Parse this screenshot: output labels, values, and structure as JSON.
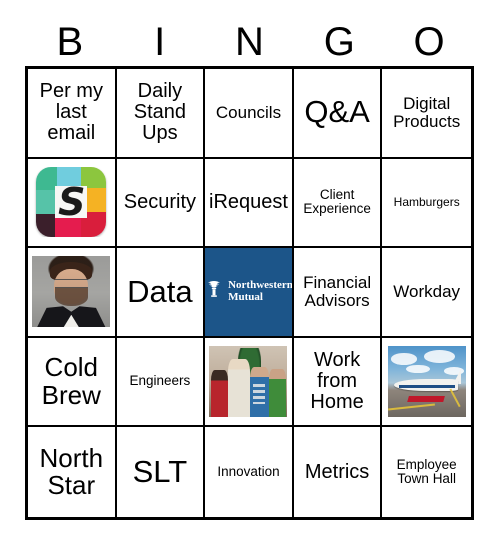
{
  "header": {
    "letters": [
      "B",
      "I",
      "N",
      "G",
      "O"
    ]
  },
  "colors": {
    "grid_line": "#000000",
    "cell_background": "#ffffff",
    "northwestern_mutual_blue": "#1c5589",
    "page_background": "#ffffff"
  },
  "grid": {
    "rows": 5,
    "columns": 5,
    "cells": [
      {
        "id": "b1",
        "column": "B",
        "row": 1,
        "type": "text",
        "label": "Per my last email",
        "size": "md"
      },
      {
        "id": "i1",
        "column": "I",
        "row": 1,
        "type": "text",
        "label": "Daily Stand Ups",
        "size": "md"
      },
      {
        "id": "n1",
        "column": "N",
        "row": 1,
        "type": "text",
        "label": "Councils",
        "size": "sm"
      },
      {
        "id": "g1",
        "column": "G",
        "row": 1,
        "type": "text",
        "label": "Q&A",
        "size": "xl"
      },
      {
        "id": "o1",
        "column": "O",
        "row": 1,
        "type": "text",
        "label": "Digital Products",
        "size": "sm"
      },
      {
        "id": "b2",
        "column": "B",
        "row": 2,
        "type": "image",
        "image": "slack-logo",
        "label": "Slack",
        "size": "sm"
      },
      {
        "id": "i2",
        "column": "I",
        "row": 2,
        "type": "text",
        "label": "Security",
        "size": "md"
      },
      {
        "id": "n2",
        "column": "N",
        "row": 2,
        "type": "text",
        "label": "iRequest",
        "size": "md"
      },
      {
        "id": "g2",
        "column": "G",
        "row": 2,
        "type": "text",
        "label": "Client Experience",
        "size": "xs"
      },
      {
        "id": "o2",
        "column": "O",
        "row": 2,
        "type": "text",
        "label": "Hamburgers",
        "size": "xxs"
      },
      {
        "id": "b3",
        "column": "B",
        "row": 3,
        "type": "image",
        "image": "headshot-photo",
        "label": "Headshot",
        "size": "sm"
      },
      {
        "id": "i3",
        "column": "I",
        "row": 3,
        "type": "text",
        "label": "Data",
        "size": "xl"
      },
      {
        "id": "n3",
        "column": "N",
        "row": 3,
        "type": "image",
        "image": "northwestern-mutual-logo",
        "label": "Northwestern Mutual",
        "size": "sm"
      },
      {
        "id": "g3",
        "column": "G",
        "row": 3,
        "type": "text",
        "label": "Financial Advisors",
        "size": "sm"
      },
      {
        "id": "o3",
        "column": "O",
        "row": 3,
        "type": "text",
        "label": "Workday",
        "size": "sm"
      },
      {
        "id": "b4",
        "column": "B",
        "row": 4,
        "type": "text",
        "label": "Cold Brew",
        "size": "lg"
      },
      {
        "id": "i4",
        "column": "I",
        "row": 4,
        "type": "text",
        "label": "Engineers",
        "size": "xs"
      },
      {
        "id": "n4",
        "column": "N",
        "row": 4,
        "type": "image",
        "image": "christmas-sweaters-photo",
        "label": "Holiday sweaters",
        "size": "sm"
      },
      {
        "id": "g4",
        "column": "G",
        "row": 4,
        "type": "text",
        "label": "Work from Home",
        "size": "md"
      },
      {
        "id": "o4",
        "column": "O",
        "row": 4,
        "type": "image",
        "image": "private-jet-photo",
        "label": "Private jet",
        "size": "sm"
      },
      {
        "id": "b5",
        "column": "B",
        "row": 5,
        "type": "text",
        "label": "North Star",
        "size": "lg"
      },
      {
        "id": "i5",
        "column": "I",
        "row": 5,
        "type": "text",
        "label": "SLT",
        "size": "xl"
      },
      {
        "id": "n5",
        "column": "N",
        "row": 5,
        "type": "text",
        "label": "Innovation",
        "size": "xs"
      },
      {
        "id": "g5",
        "column": "G",
        "row": 5,
        "type": "text",
        "label": "Metrics",
        "size": "md"
      },
      {
        "id": "o5",
        "column": "O",
        "row": 5,
        "type": "text",
        "label": "Employee Town Hall",
        "size": "xs"
      }
    ]
  },
  "logos": {
    "northwestern_mutual": {
      "line1": "Northwestern",
      "line2": "Mutual"
    },
    "slack": {
      "letter": "S"
    }
  }
}
